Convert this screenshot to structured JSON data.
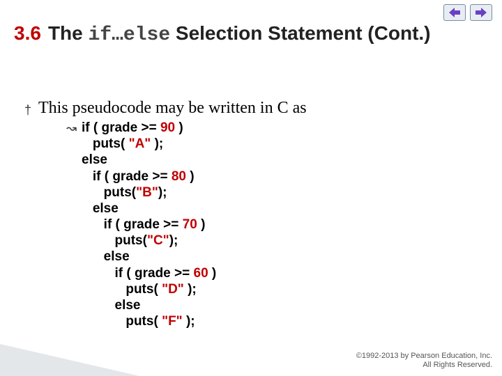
{
  "heading": {
    "section_num": "3.6",
    "pre": "The ",
    "code": "if…else",
    "post": " Selection Statement (Cont.)"
  },
  "intro": "This pseudocode may be written in C as",
  "code": {
    "l1a": "if ( grade >= ",
    "l1b": "90",
    "l1c": " )",
    "l2a": "   puts( ",
    "l2b": "\"A\"",
    "l2c": " );",
    "l3": "else",
    "l4a": "   if ( grade >= ",
    "l4b": "80",
    "l4c": " )",
    "l5a": "      puts(",
    "l5b": "\"B\"",
    "l5c": ");",
    "l6": "   else",
    "l7a": "      if ( grade >= ",
    "l7b": "70",
    "l7c": " )",
    "l8a": "         puts(",
    "l8b": "\"C\"",
    "l8c": ");",
    "l9": "      else",
    "l10a": "         if ( grade >= ",
    "l10b": "60",
    "l10c": " )",
    "l11a": "            puts( ",
    "l11b": "\"D\"",
    "l11c": " );",
    "l12": "         else",
    "l13a": "            puts( ",
    "l13b": "\"F\"",
    "l13c": " );"
  },
  "footer": {
    "line1": "©1992-2013 by Pearson Education, Inc.",
    "line2": "All Rights Reserved."
  },
  "nav": {
    "prev": "prev-slide",
    "next": "next-slide"
  }
}
